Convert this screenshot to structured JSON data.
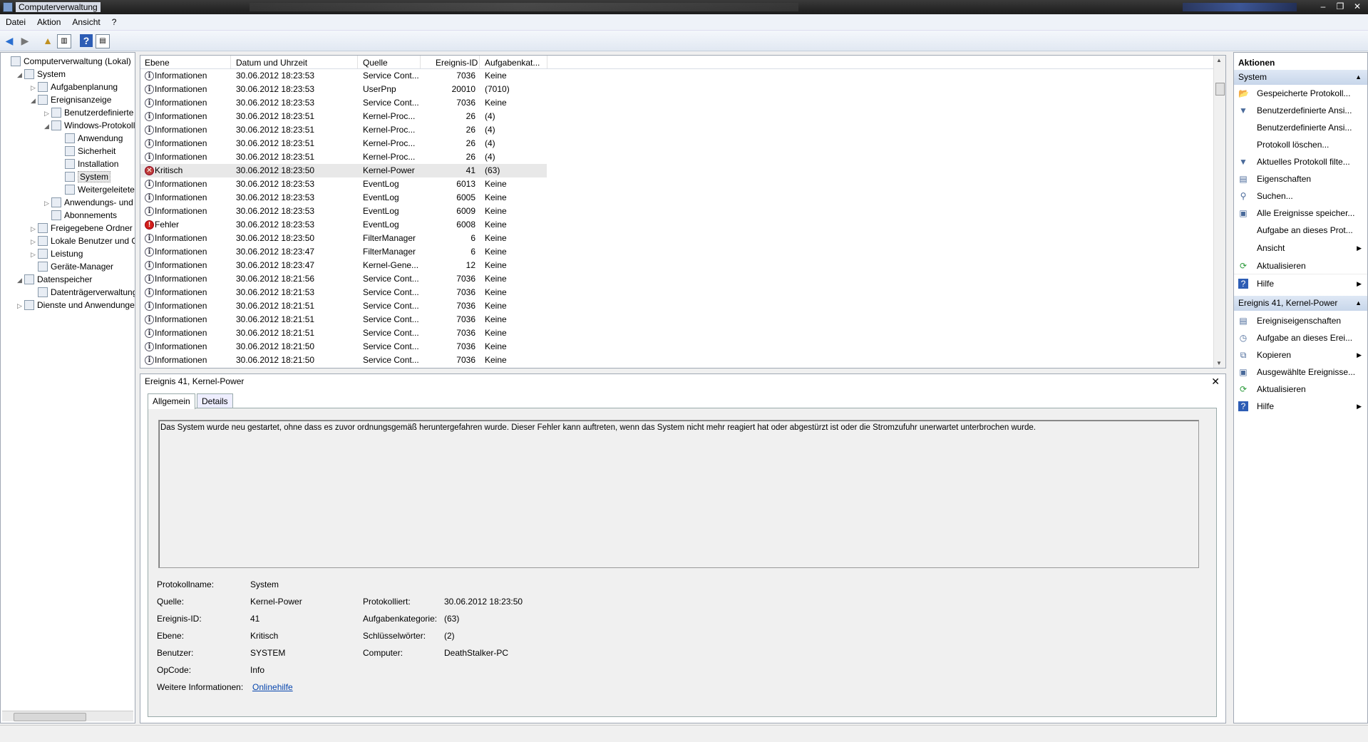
{
  "window": {
    "title": "Computerverwaltung",
    "controls": [
      "–",
      "❐",
      "✕"
    ]
  },
  "menu": [
    "Datei",
    "Aktion",
    "Ansicht",
    "?"
  ],
  "toolbar": {
    "icons": [
      "back-icon",
      "forward-icon",
      "up-icon",
      "show-hide-tree-icon",
      "help-icon",
      "show-hide-action-icon"
    ]
  },
  "tree": [
    {
      "label": "Computerverwaltung (Lokal)",
      "level": 0,
      "exp": "",
      "icon": "computer-icon"
    },
    {
      "label": "System",
      "level": 1,
      "exp": "◢",
      "icon": "tools-icon"
    },
    {
      "label": "Aufgabenplanung",
      "level": 2,
      "exp": "▷",
      "icon": "clock-icon"
    },
    {
      "label": "Ereignisanzeige",
      "level": 2,
      "exp": "◢",
      "icon": "event-viewer-icon"
    },
    {
      "label": "Benutzerdefinierte A",
      "level": 3,
      "exp": "▷",
      "icon": "folder-icon"
    },
    {
      "label": "Windows-Protokolle",
      "level": 3,
      "exp": "◢",
      "icon": "folder-icon"
    },
    {
      "label": "Anwendung",
      "level": 4,
      "exp": "",
      "icon": "log-icon"
    },
    {
      "label": "Sicherheit",
      "level": 4,
      "exp": "",
      "icon": "log-icon"
    },
    {
      "label": "Installation",
      "level": 4,
      "exp": "",
      "icon": "log-icon"
    },
    {
      "label": "System",
      "level": 4,
      "exp": "",
      "icon": "log-icon",
      "selected": true
    },
    {
      "label": "Weitergeleitete E",
      "level": 4,
      "exp": "",
      "icon": "log-icon"
    },
    {
      "label": "Anwendungs- und D",
      "level": 3,
      "exp": "▷",
      "icon": "folder-icon"
    },
    {
      "label": "Abonnements",
      "level": 3,
      "exp": "",
      "icon": "subscription-icon"
    },
    {
      "label": "Freigegebene Ordner",
      "level": 2,
      "exp": "▷",
      "icon": "shared-folder-icon"
    },
    {
      "label": "Lokale Benutzer und Gr",
      "level": 2,
      "exp": "▷",
      "icon": "users-icon"
    },
    {
      "label": "Leistung",
      "level": 2,
      "exp": "▷",
      "icon": "performance-icon"
    },
    {
      "label": "Geräte-Manager",
      "level": 2,
      "exp": "",
      "icon": "device-manager-icon"
    },
    {
      "label": "Datenspeicher",
      "level": 1,
      "exp": "◢",
      "icon": "storage-icon"
    },
    {
      "label": "Datenträgerverwaltung",
      "level": 2,
      "exp": "",
      "icon": "disk-icon"
    },
    {
      "label": "Dienste und Anwendungen",
      "level": 1,
      "exp": "▷",
      "icon": "services-icon"
    }
  ],
  "list": {
    "columns": [
      "Ebene",
      "Datum und Uhrzeit",
      "Quelle",
      "Ereignis-ID",
      "Aufgabenkat..."
    ],
    "rows": [
      {
        "level": "Informationen",
        "type": "info",
        "date": "30.06.2012 18:23:53",
        "source": "Service Cont...",
        "id": "7036",
        "cat": "Keine"
      },
      {
        "level": "Informationen",
        "type": "info",
        "date": "30.06.2012 18:23:53",
        "source": "UserPnp",
        "id": "20010",
        "cat": "(7010)"
      },
      {
        "level": "Informationen",
        "type": "info",
        "date": "30.06.2012 18:23:53",
        "source": "Service Cont...",
        "id": "7036",
        "cat": "Keine"
      },
      {
        "level": "Informationen",
        "type": "info",
        "date": "30.06.2012 18:23:51",
        "source": "Kernel-Proc...",
        "id": "26",
        "cat": "(4)"
      },
      {
        "level": "Informationen",
        "type": "info",
        "date": "30.06.2012 18:23:51",
        "source": "Kernel-Proc...",
        "id": "26",
        "cat": "(4)"
      },
      {
        "level": "Informationen",
        "type": "info",
        "date": "30.06.2012 18:23:51",
        "source": "Kernel-Proc...",
        "id": "26",
        "cat": "(4)"
      },
      {
        "level": "Informationen",
        "type": "info",
        "date": "30.06.2012 18:23:51",
        "source": "Kernel-Proc...",
        "id": "26",
        "cat": "(4)"
      },
      {
        "level": "Kritisch",
        "type": "crit",
        "date": "30.06.2012 18:23:50",
        "source": "Kernel-Power",
        "id": "41",
        "cat": "(63)",
        "selected": true
      },
      {
        "level": "Informationen",
        "type": "info",
        "date": "30.06.2012 18:23:53",
        "source": "EventLog",
        "id": "6013",
        "cat": "Keine"
      },
      {
        "level": "Informationen",
        "type": "info",
        "date": "30.06.2012 18:23:53",
        "source": "EventLog",
        "id": "6005",
        "cat": "Keine"
      },
      {
        "level": "Informationen",
        "type": "info",
        "date": "30.06.2012 18:23:53",
        "source": "EventLog",
        "id": "6009",
        "cat": "Keine"
      },
      {
        "level": "Fehler",
        "type": "err",
        "date": "30.06.2012 18:23:53",
        "source": "EventLog",
        "id": "6008",
        "cat": "Keine"
      },
      {
        "level": "Informationen",
        "type": "info",
        "date": "30.06.2012 18:23:50",
        "source": "FilterManager",
        "id": "6",
        "cat": "Keine"
      },
      {
        "level": "Informationen",
        "type": "info",
        "date": "30.06.2012 18:23:47",
        "source": "FilterManager",
        "id": "6",
        "cat": "Keine"
      },
      {
        "level": "Informationen",
        "type": "info",
        "date": "30.06.2012 18:23:47",
        "source": "Kernel-Gene...",
        "id": "12",
        "cat": "Keine"
      },
      {
        "level": "Informationen",
        "type": "info",
        "date": "30.06.2012 18:21:56",
        "source": "Service Cont...",
        "id": "7036",
        "cat": "Keine"
      },
      {
        "level": "Informationen",
        "type": "info",
        "date": "30.06.2012 18:21:53",
        "source": "Service Cont...",
        "id": "7036",
        "cat": "Keine"
      },
      {
        "level": "Informationen",
        "type": "info",
        "date": "30.06.2012 18:21:51",
        "source": "Service Cont...",
        "id": "7036",
        "cat": "Keine"
      },
      {
        "level": "Informationen",
        "type": "info",
        "date": "30.06.2012 18:21:51",
        "source": "Service Cont...",
        "id": "7036",
        "cat": "Keine"
      },
      {
        "level": "Informationen",
        "type": "info",
        "date": "30.06.2012 18:21:51",
        "source": "Service Cont...",
        "id": "7036",
        "cat": "Keine"
      },
      {
        "level": "Informationen",
        "type": "info",
        "date": "30.06.2012 18:21:50",
        "source": "Service Cont...",
        "id": "7036",
        "cat": "Keine"
      },
      {
        "level": "Informationen",
        "type": "info",
        "date": "30.06.2012 18:21:50",
        "source": "Service Cont...",
        "id": "7036",
        "cat": "Keine"
      }
    ]
  },
  "detail": {
    "title": "Ereignis 41, Kernel-Power",
    "close": "✕",
    "tabs": [
      "Allgemein",
      "Details"
    ],
    "message": "Das System wurde neu gestartet, ohne dass es zuvor ordnungsgemäß heruntergefahren wurde. Dieser Fehler kann auftreten, wenn das System nicht mehr reagiert hat oder abgestürzt ist oder die Stromzufuhr unerwartet unterbrochen wurde.",
    "labels": {
      "log_name": "Protokollname:",
      "source": "Quelle:",
      "event_id": "Ereignis-ID:",
      "level": "Ebene:",
      "user": "Benutzer:",
      "opcode": "OpCode:",
      "more_info": "Weitere Informationen:",
      "logged": "Protokolliert:",
      "task_category": "Aufgabenkategorie:",
      "keywords": "Schlüsselwörter:",
      "computer": "Computer:"
    },
    "values": {
      "log_name": "System",
      "source": "Kernel-Power",
      "event_id": "41",
      "level": "Kritisch",
      "user": "SYSTEM",
      "opcode": "Info",
      "more_info": "Onlinehilfe",
      "logged": "30.06.2012 18:23:50",
      "task_category": "(63)",
      "keywords": "(2)",
      "computer": "DeathStalker-PC"
    }
  },
  "actions": {
    "header": "Aktionen",
    "section1": "System",
    "items1": [
      {
        "label": "Gespeicherte Protokoll...",
        "icon": "open-log-icon",
        "glyph": "📂"
      },
      {
        "label": "Benutzerdefinierte Ansi...",
        "icon": "filter-icon",
        "glyph": "▼"
      },
      {
        "label": "Benutzerdefinierte Ansi...",
        "icon": "",
        "glyph": ""
      },
      {
        "label": "Protokoll löschen...",
        "icon": "",
        "glyph": ""
      },
      {
        "label": "Aktuelles Protokoll filte...",
        "icon": "filter-icon",
        "glyph": "▼"
      },
      {
        "label": "Eigenschaften",
        "icon": "properties-icon",
        "glyph": "▤"
      },
      {
        "label": "Suchen...",
        "icon": "find-icon",
        "glyph": "⚲"
      },
      {
        "label": "Alle Ereignisse speicher...",
        "icon": "save-icon",
        "glyph": "▣"
      },
      {
        "label": "Aufgabe an dieses Prot...",
        "icon": "",
        "glyph": ""
      },
      {
        "label": "Ansicht",
        "icon": "",
        "glyph": "",
        "submenu": true
      },
      {
        "label": "Aktualisieren",
        "icon": "refresh-icon",
        "glyph": "⟳"
      },
      {
        "label": "Hilfe",
        "icon": "help-icon",
        "glyph": "?",
        "submenu": true
      }
    ],
    "section2": "Ereignis 41, Kernel-Power",
    "items2": [
      {
        "label": "Ereigniseigenschaften",
        "icon": "properties-icon",
        "glyph": "▤"
      },
      {
        "label": "Aufgabe an dieses Erei...",
        "icon": "task-icon",
        "glyph": "◷"
      },
      {
        "label": "Kopieren",
        "icon": "copy-icon",
        "glyph": "⧉",
        "submenu": true
      },
      {
        "label": "Ausgewählte Ereignisse...",
        "icon": "save-icon",
        "glyph": "▣"
      },
      {
        "label": "Aktualisieren",
        "icon": "refresh-icon",
        "glyph": "⟳"
      },
      {
        "label": "Hilfe",
        "icon": "help-icon",
        "glyph": "?",
        "submenu": true
      }
    ]
  },
  "colors": {
    "info_icon": "#334455",
    "critical_icon": "#c0403a",
    "error_icon": "#d2201a",
    "link": "#0645ad",
    "section_header": "#c7d6ea"
  }
}
